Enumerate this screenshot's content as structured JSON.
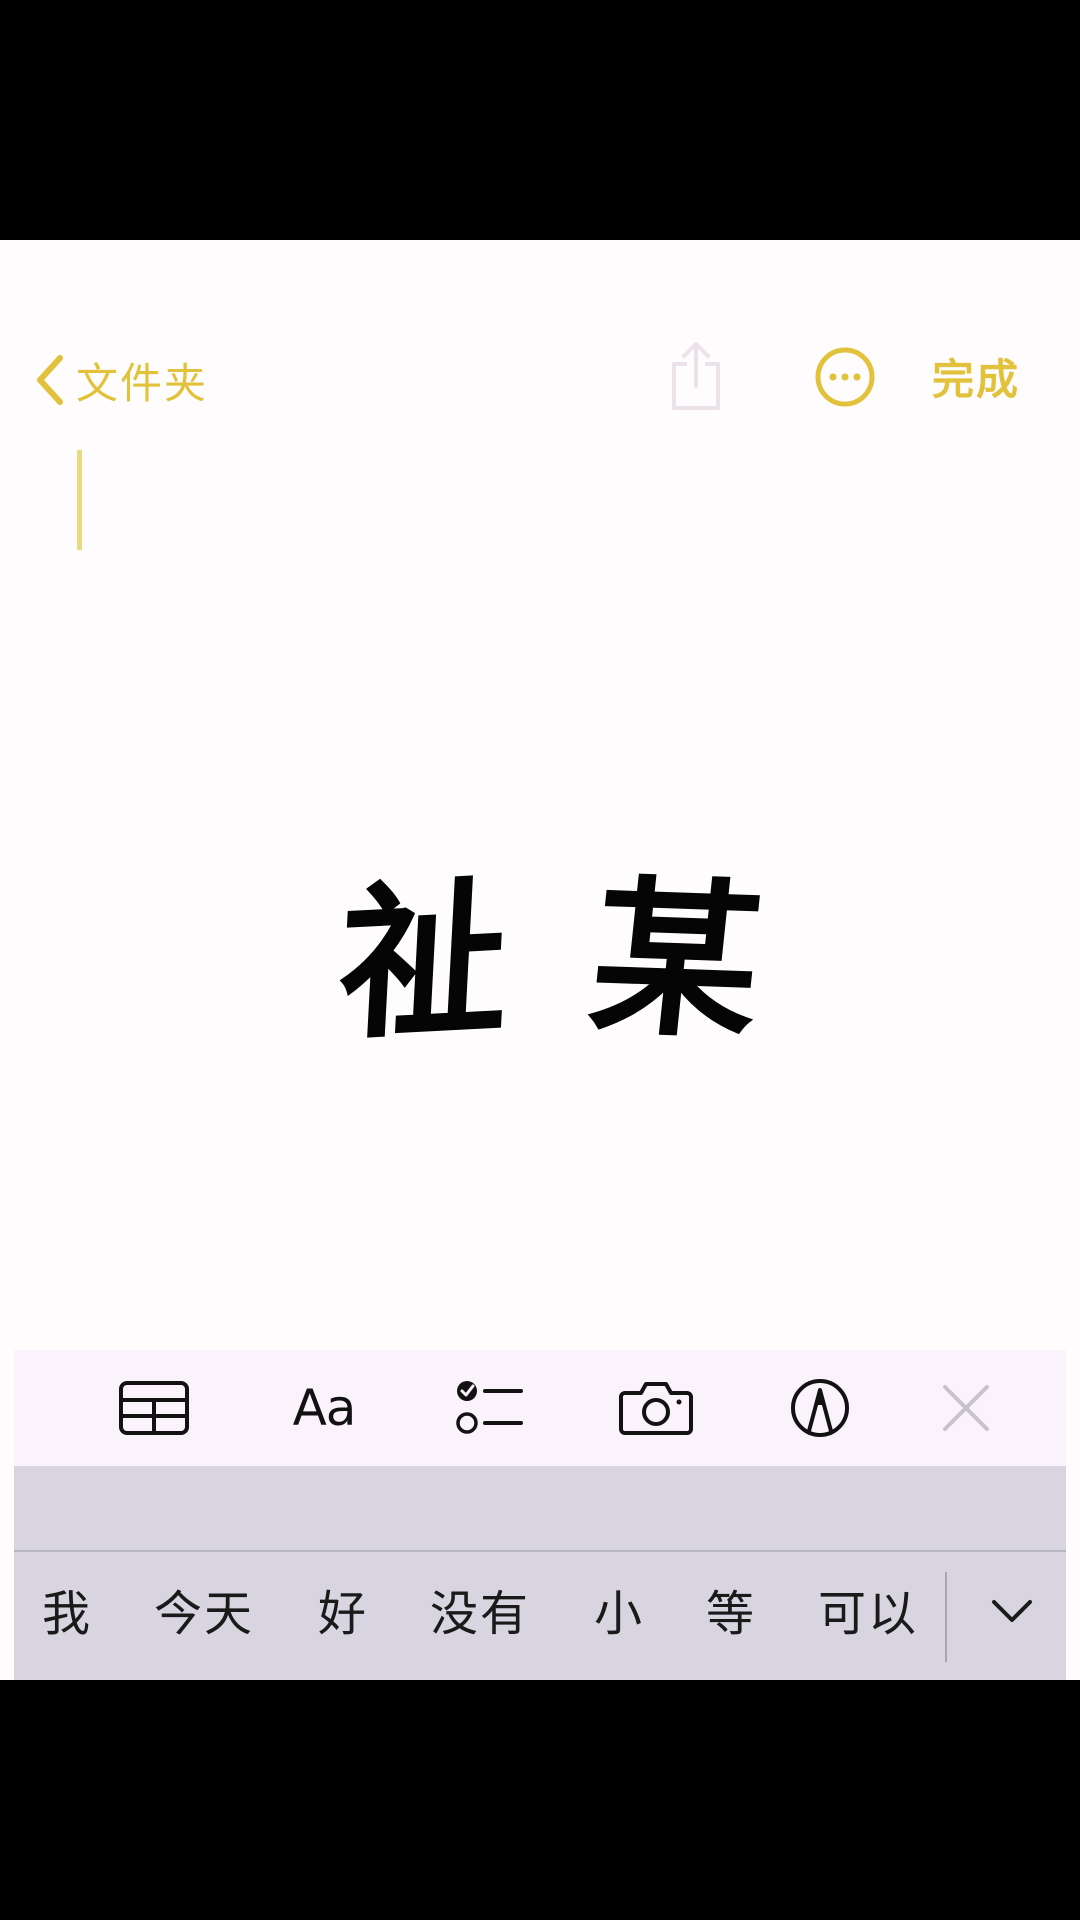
{
  "nav": {
    "back_label": "文件夹",
    "done_label": "完成",
    "accent_color": "#e2c23a"
  },
  "note": {
    "text_char_1": "祉",
    "text_char_2": "某"
  },
  "toolbar": {
    "items": [
      "table-icon",
      "format-icon",
      "checklist-icon",
      "camera-icon",
      "markup-icon",
      "close-icon"
    ],
    "format_label": "Aa"
  },
  "keyboard": {
    "candidates": [
      "我",
      "今天",
      "好",
      "没有",
      "小",
      "等",
      "可以"
    ]
  }
}
